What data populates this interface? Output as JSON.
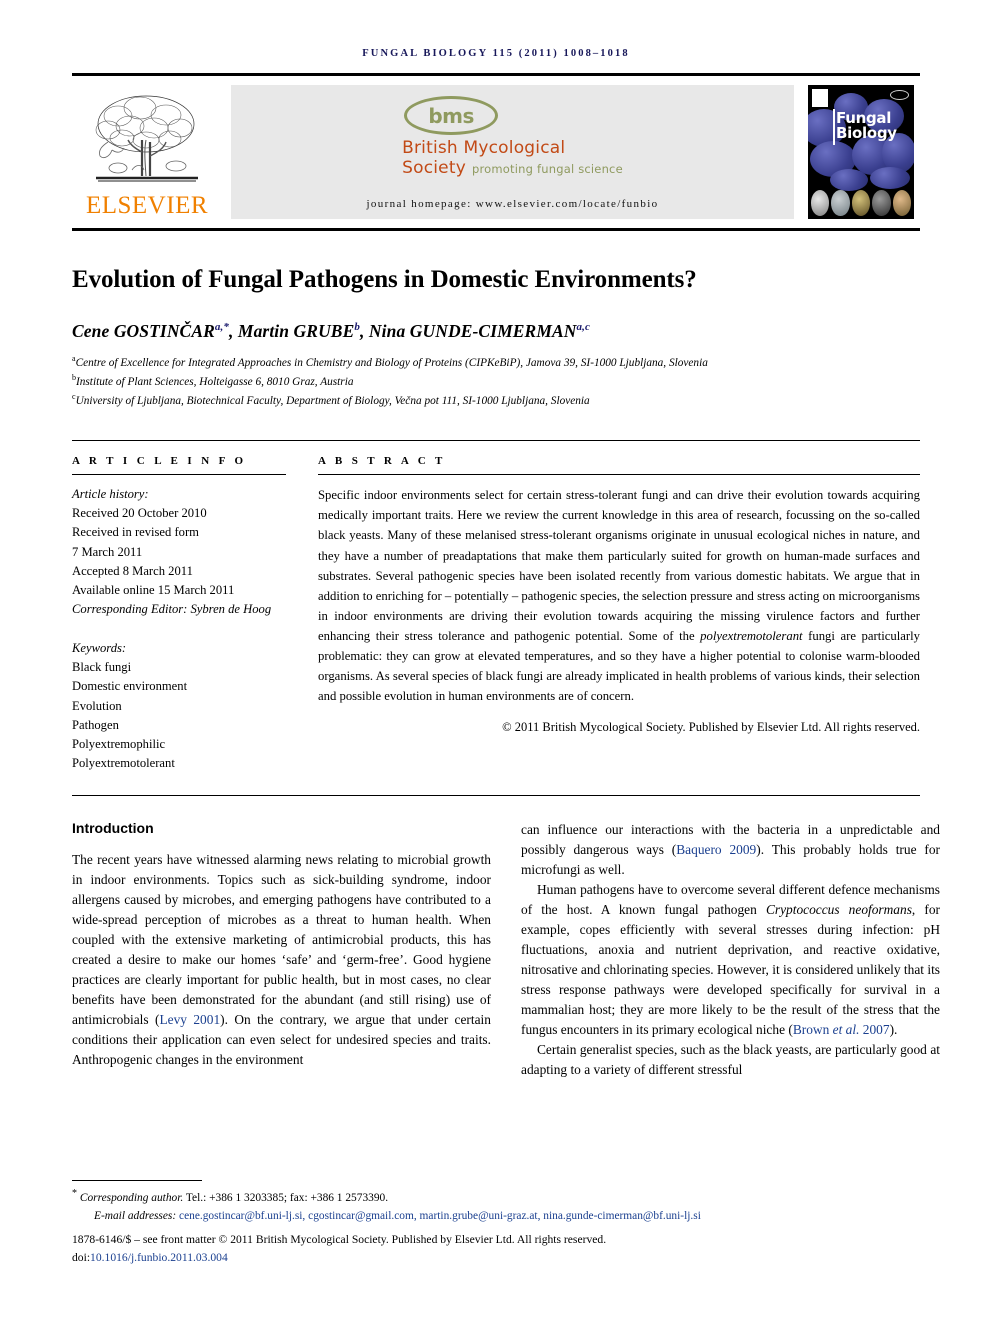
{
  "running_head": "FUNGAL BIOLOGY 115 (2011) 1008–1018",
  "masthead": {
    "publisher_name": "ELSEVIER",
    "publisher_logo_alt": "elsevier-tree-logo",
    "society_acronym": "bms",
    "society_line1": "British Mycological",
    "society_line2": "Society",
    "society_tagline": "promoting fungal science",
    "journal_homepage": "journal homepage: www.elsevier.com/locate/funbio",
    "cover_title_line1": "Fungal",
    "cover_title_line2": "Biology"
  },
  "article": {
    "title": "Evolution of Fungal Pathogens in Domestic Environments?",
    "authors_html": "Cene GOSTINČAR<sup>a,*</sup>, Martin GRUBE<sup>b</sup>, Nina GUNDE-CIMERMAN<sup>a,c</sup>",
    "affiliations": [
      {
        "marker": "a",
        "text": "Centre of Excellence for Integrated Approaches in Chemistry and Biology of Proteins (CIPKeBiP), Jamova 39, SI-1000 Ljubljana, Slovenia"
      },
      {
        "marker": "b",
        "text": "Institute of Plant Sciences, Holteigasse 6, 8010 Graz, Austria"
      },
      {
        "marker": "c",
        "text": "University of Ljubljana, Biotechnical Faculty, Department of Biology, Večna pot 111, SI-1000 Ljubljana, Slovenia"
      }
    ]
  },
  "article_info": {
    "heading": "A R T I C L E  I N F O",
    "history_label": "Article history:",
    "history": [
      "Received 20 October 2010",
      "Received in revised form",
      "7 March 2011",
      "Accepted 8 March 2011",
      "Available online 15 March 2011"
    ],
    "editor_line": "Corresponding Editor: Sybren de Hoog",
    "keywords_label": "Keywords:",
    "keywords": [
      "Black fungi",
      "Domestic environment",
      "Evolution",
      "Pathogen",
      "Polyextremophilic",
      "Polyextremotolerant"
    ]
  },
  "abstract": {
    "heading": "A B S T R A C T",
    "paragraph_html": "Specific indoor environments select for certain stress-tolerant fungi and can drive their evolution towards acquiring medically important traits. Here we review the current knowledge in this area of research, focussing on the so-called black yeasts. Many of these melanised stress-tolerant organisms originate in unusual ecological niches in nature, and they have a number of preadaptations that make them particularly suited for growth on human-made surfaces and substrates. Several pathogenic species have been isolated recently from various domestic habitats. We argue that in addition to enriching for &ndash; potentially &ndash; pathogenic species, the selection pressure and stress acting on microorganisms in indoor environments are driving their evolution towards acquiring the missing virulence factors and further enhancing their stress tolerance and pathogenic potential. Some of the <i>polyextremotolerant</i> fungi are particularly problematic: they can grow at elevated temperatures, and so they have a higher potential to colonise warm-blooded organisms. As several species of black fungi are already implicated in health problems of various kinds, their selection and possible evolution in human environments are of concern.",
    "copyright": "© 2011 British Mycological Society. Published by Elsevier Ltd. All rights reserved."
  },
  "body": {
    "intro_heading": "Introduction",
    "left_p1_html": "The recent years have witnessed alarming news relating to microbial growth in indoor environments. Topics such as sick-building syndrome, indoor allergens caused by microbes, and emerging pathogens have contributed to a wide-spread perception of microbes as a threat to human health. When coupled with the extensive marketing of antimicrobial products, this has created a desire to make our homes &lsquo;safe&rsquo; and &lsquo;germ-free&rsquo;. Good hygiene practices are clearly important for public health, but in most cases, no clear benefits have been demonstrated for the abundant (and still rising) use of antimicrobials (<span class=\"cite\">Levy 2001</span>). On the contrary, we argue that under certain conditions their application can even select for undesired species and traits. Anthropogenic changes in the environment",
    "right_p1_html": "can influence our interactions with the bacteria in a unpredictable and possibly dangerous ways (<span class=\"cite\">Baquero 2009</span>). This probably holds true for microfungi as well.",
    "right_p2_html": "Human pathogens have to overcome several different defence mechanisms of the host. A known fungal pathogen <i>Cryptococcus neoformans</i>, for example, copes efficiently with several stresses during infection: pH fluctuations, anoxia and nutrient deprivation, and reactive oxidative, nitrosative and chlorinating species. However, it is considered unlikely that its stress response pathways were developed specifically for survival in a mammalian host; they are more likely to be the result of the stress that the fungus encounters in its primary ecological niche (<span class=\"cite\">Brown <i>et al.</i> 2007</span>).",
    "right_p3_html": "Certain generalist species, such as the black yeasts, are particularly good at adapting to a variety of different stressful"
  },
  "footer": {
    "corresponding_html": "<span class=\"foot-star\">*</span> <span class=\"foot-ital\">Corresponding author.</span> Tel.: +386 1 3203385; fax: +386 1 2573390.",
    "email_label": "E-mail addresses:",
    "emails": [
      "cene.gostincar@bf.uni-lj.si,",
      "cgostincar@gmail.com,",
      "martin.grube@uni-graz.at,",
      "nina.gunde-cimerman@bf.uni-lj.si"
    ],
    "front_matter": "1878-6146/$ – see front matter © 2011 British Mycological Society. Published by Elsevier Ltd. All rights reserved.",
    "doi_prefix": "doi:",
    "doi_value": "10.1016/j.funbio.2011.03.004"
  },
  "colors": {
    "running_head": "#18185a",
    "elsevier_orange": "#f08000",
    "bms_green": "#8f9a5f",
    "bms_orange": "#c24a16",
    "citation_blue": "#1a3f8f",
    "band_gray": "#e8e8e8"
  }
}
